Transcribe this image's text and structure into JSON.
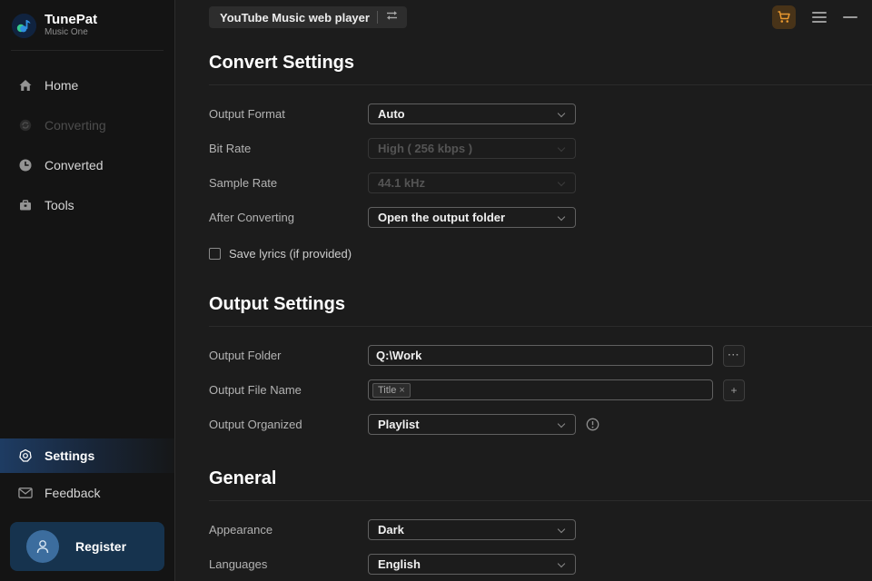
{
  "app": {
    "name": "TunePat",
    "edition": "Music One"
  },
  "colors": {
    "accent_orange": "#e9982f",
    "register_bg": "#16334e",
    "avatar_circle": "#3c6d9e",
    "active_highlight": "#1e3c63",
    "background_main": "#1c1c1c",
    "background_sidebar": "#141414"
  },
  "topbar": {
    "source_button": "YouTube Music web player"
  },
  "sidebar": {
    "items": [
      {
        "label": "Home",
        "state": "normal"
      },
      {
        "label": "Converting",
        "state": "disabled"
      },
      {
        "label": "Converted",
        "state": "normal"
      },
      {
        "label": "Tools",
        "state": "normal"
      }
    ],
    "settings_label": "Settings",
    "feedback_label": "Feedback",
    "register_label": "Register"
  },
  "convert_settings": {
    "title": "Convert Settings",
    "output_format": {
      "label": "Output Format",
      "value": "Auto"
    },
    "bit_rate": {
      "label": "Bit Rate",
      "value": "High ( 256 kbps )",
      "disabled": true
    },
    "sample_rate": {
      "label": "Sample Rate",
      "value": "44.1 kHz",
      "disabled": true
    },
    "after_converting": {
      "label": "After Converting",
      "value": "Open the output folder"
    },
    "save_lyrics": {
      "label": "Save lyrics (if provided)",
      "checked": false
    }
  },
  "output_settings": {
    "title": "Output Settings",
    "output_folder": {
      "label": "Output Folder",
      "value": "Q:\\Work",
      "browse_glyph": "···"
    },
    "output_file_name": {
      "label": "Output File Name",
      "tag": "Title",
      "tag_close": "×",
      "add_glyph": "+"
    },
    "output_organized": {
      "label": "Output Organized",
      "value": "Playlist"
    }
  },
  "general": {
    "title": "General",
    "appearance": {
      "label": "Appearance",
      "value": "Dark"
    },
    "languages": {
      "label": "Languages",
      "value": "English"
    }
  }
}
